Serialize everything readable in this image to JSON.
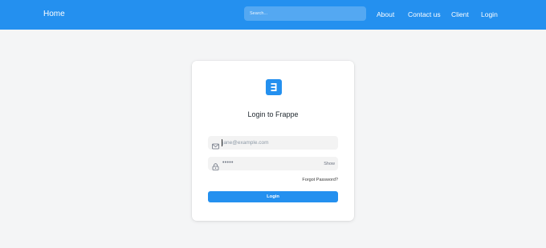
{
  "navbar": {
    "brand": "Home",
    "search_placeholder": "Search...",
    "links": [
      "About",
      "Contact us",
      "Client",
      "Login"
    ],
    "background": "#2490ef"
  },
  "login": {
    "logo_icon": "frappe-logo",
    "title": "Login to Frappe",
    "email_placeholder": "jane@example.com",
    "password_value": "•••••",
    "show_label": "Show",
    "forgot_label": "Forgot Password?",
    "submit_label": "Login",
    "accent": "#2490ef"
  },
  "icons": {
    "email": "mail-icon",
    "password": "lock-icon"
  }
}
